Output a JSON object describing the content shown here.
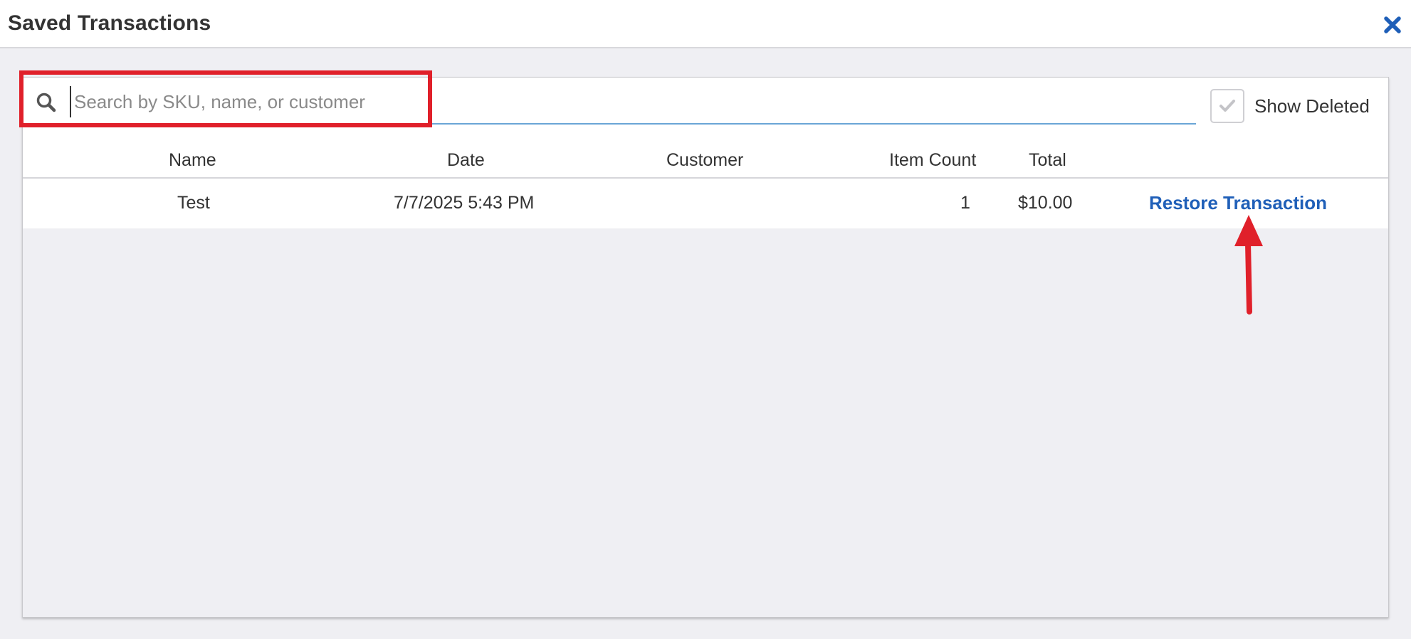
{
  "dialog": {
    "title": "Saved Transactions"
  },
  "search": {
    "placeholder": "Search by SKU, name, or customer",
    "value": ""
  },
  "show_deleted": {
    "label": "Show Deleted",
    "checked": true
  },
  "table": {
    "columns": [
      "Name",
      "Date",
      "Customer",
      "Item Count",
      "Total"
    ],
    "rows": [
      {
        "name": "Test",
        "date": "7/7/2025 5:43 PM",
        "customer": "",
        "item_count": "1",
        "total": "$10.00",
        "action": "Restore Transaction"
      }
    ]
  },
  "icons": {
    "close": "close-icon",
    "search": "search-icon",
    "check": "checkmark-icon"
  },
  "colors": {
    "link": "#1f5fb8",
    "annotation": "#e0202a",
    "background": "#efeff3"
  }
}
